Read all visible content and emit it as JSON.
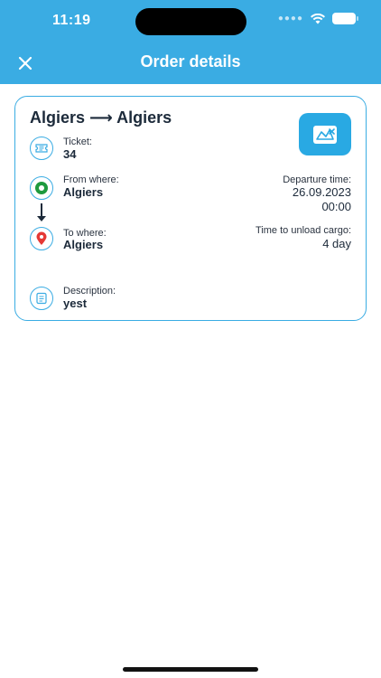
{
  "status": {
    "time": "11:19"
  },
  "header": {
    "title": "Order details"
  },
  "order": {
    "route_title": "Algiers ⟶ Algiers",
    "ticket_label": "Ticket:",
    "ticket_value": "34",
    "from_label": "From where:",
    "from_value": "Algiers",
    "to_label": "To where:",
    "to_value": "Algiers",
    "departure_label": "Departure time:",
    "departure_date": "26.09.2023",
    "departure_time": "00:00",
    "unload_label": "Time to unload cargo:",
    "unload_value": "4 day",
    "description_label": "Description:",
    "description_value": "yest"
  },
  "icons": {
    "close": "close-icon",
    "map": "map-icon",
    "ticket": "ticket-icon",
    "from": "origin-pin-icon",
    "to": "destination-pin-icon",
    "description": "document-icon"
  },
  "colors": {
    "accent": "#3aace3",
    "map_button": "#29a9e3",
    "origin_green": "#1f9a3e",
    "destination_red": "#e53935"
  }
}
